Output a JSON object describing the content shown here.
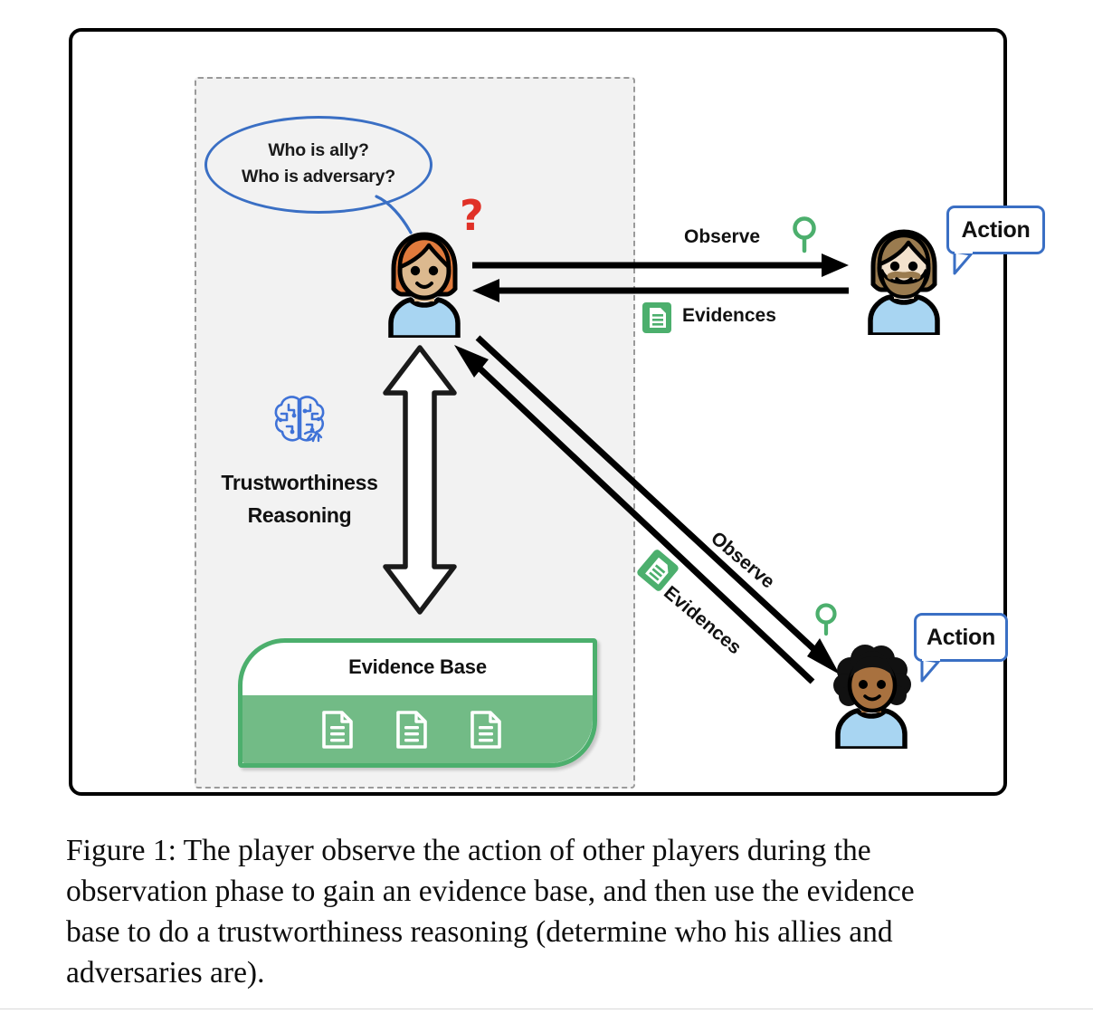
{
  "figure": {
    "thought_bubble": {
      "line1": "Who is ally?",
      "line2": "Who is adversary?"
    },
    "confusion_marker": "?",
    "reasoning": {
      "line1": "Trustworthiness",
      "line2": "Reasoning",
      "icon": "brain-icon"
    },
    "evidence_base": {
      "title": "Evidence Base",
      "documents": [
        "document-icon",
        "document-icon",
        "document-icon"
      ]
    },
    "interactions": [
      {
        "observe_label": "Observe",
        "observe_icon": "magnifier-icon",
        "evidences_label": "Evidences",
        "evidences_icon": "evidence-document-icon",
        "action_label": "Action",
        "player": "bearded-player"
      },
      {
        "observe_label": "Observe",
        "observe_icon": "magnifier-icon",
        "evidences_label": "Evidences",
        "evidences_icon": "evidence-document-icon",
        "action_label": "Action",
        "player": "curly-hair-player"
      }
    ],
    "colors": {
      "frame_border": "#000000",
      "dashed_panel_border": "#9a9a9a",
      "dashed_panel_fill": "#f2f2f2",
      "bubble_blue": "#3a6fc4",
      "evidence_green": "#4caf6d",
      "evidence_green_fill": "#72bb86",
      "question_red": "#e03127",
      "brain_blue": "#3f72d7",
      "shirt_blue": "#a8d5f2"
    }
  },
  "caption": {
    "text": "Figure 1: The player observe the action of other players during the observation phase to gain an evidence base, and then use the evidence base to do a trustworthiness reasoning (determine who his allies and adversaries are)."
  }
}
